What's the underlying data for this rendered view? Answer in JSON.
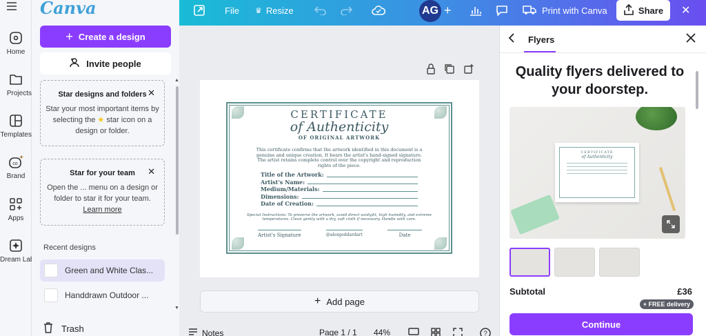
{
  "brand": {
    "logo": "Canva",
    "accent": "#8b3dff"
  },
  "rail": [
    {
      "label": "Home",
      "icon": "home-icon"
    },
    {
      "label": "Projects",
      "icon": "folder-icon"
    },
    {
      "label": "Templates",
      "icon": "templates-icon"
    },
    {
      "label": "Brand",
      "icon": "brand-icon"
    },
    {
      "label": "Apps",
      "icon": "apps-icon"
    },
    {
      "label": "Dream Lab",
      "icon": "dream-lab-icon"
    }
  ],
  "panel": {
    "create_label": "Create a design",
    "invite_label": "Invite people",
    "star_designs": {
      "title": "Star designs and folders",
      "body_before": "Star your most important items by selecting the",
      "body_after": "star icon on a design or folder."
    },
    "star_team": {
      "title": "Star for your team",
      "body": "Open the ... menu on a design or folder to star it for your team.",
      "link": "Learn more"
    },
    "recent_title": "Recent designs",
    "recent": [
      {
        "title": "Green and White Clas..."
      },
      {
        "title": "Handdrawn Outdoor ..."
      }
    ],
    "trash_label": "Trash"
  },
  "toolbar": {
    "file": "File",
    "resize": "Resize",
    "avatar": "AG",
    "print": "Print with Canva",
    "share": "Share"
  },
  "certificate": {
    "title": "CERTIFICATE",
    "script": "of Authenticity",
    "subtitle": "OF ORIGINAL ARTWORK",
    "body": "This certificate confirms that the artwork identified in this document is a genuine and unique creation. It bears the artist's hand-signed signature. The artist retains complete control over the copyright and reproduction rights of the piece.",
    "fields": [
      "Title of the Artwork:",
      "Artist's Name:",
      "Medium/Materials:",
      "Dimensions:",
      "Date of Creation:"
    ],
    "note": "Special Instructions: To preserve the artwork, avoid direct sunlight, high humidity, and extreme temperatures. Clean gently with a dry, soft cloth if necessary. Handle with care.",
    "sign_left": "Artist's Signature",
    "sign_mid": "@alexgoddardart",
    "sign_right": "Date"
  },
  "canvas": {
    "add_page": "Add page",
    "notes": "Notes",
    "page_indicator": "Page 1 / 1",
    "zoom": "44%"
  },
  "right_panel": {
    "tab": "Flyers",
    "headline": "Quality flyers delivered to your doorstep.",
    "mock_title": "CERTIFICATE",
    "mock_script": "of Authenticity",
    "subtotal_label": "Subtotal",
    "subtotal_value": "£36",
    "delivery_badge": "+ FREE delivery",
    "continue_label": "Continue"
  }
}
